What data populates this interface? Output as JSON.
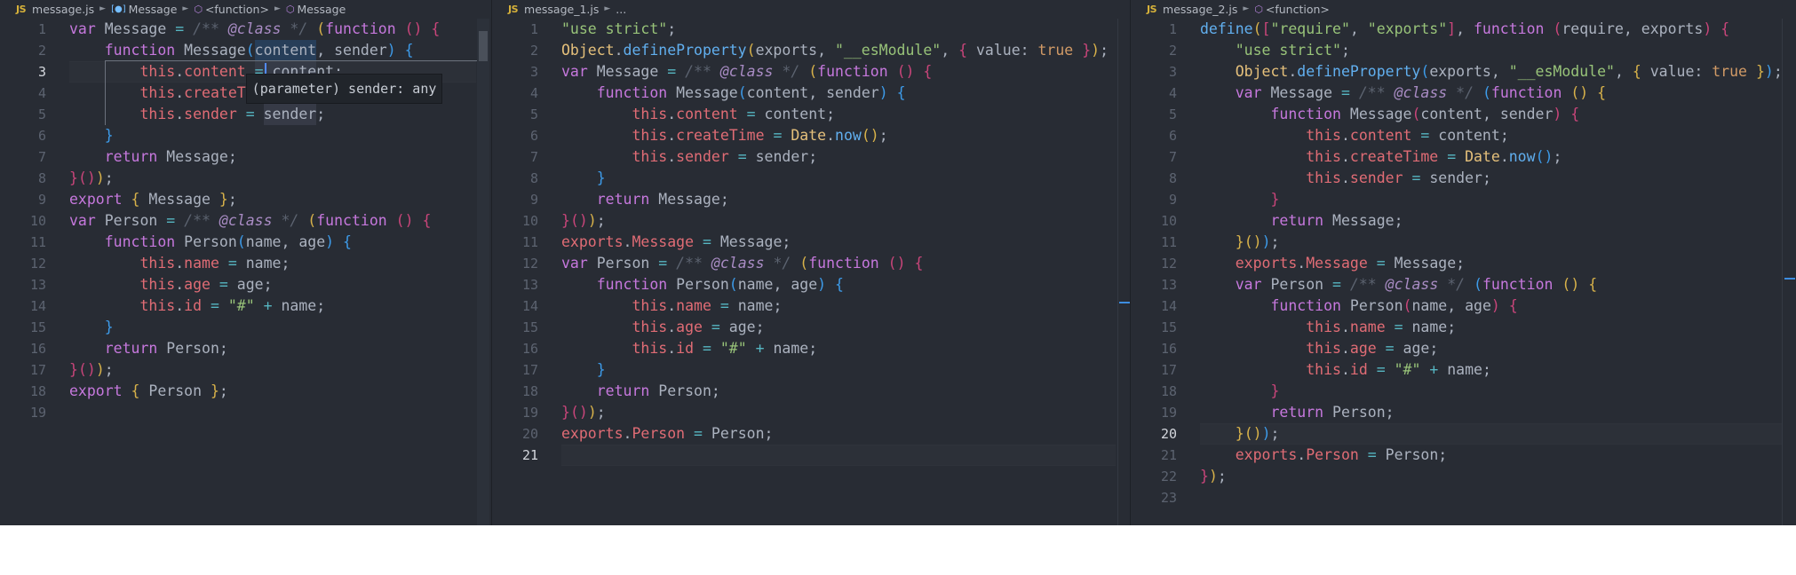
{
  "colors": {
    "background": "#282c34",
    "keyword": "#c678dd",
    "function": "#61afef",
    "property": "#e06c75",
    "string": "#98c379",
    "type": "#e5c07b",
    "operator": "#56b6c2",
    "comment": "#5c6370"
  },
  "editors": [
    {
      "breadcrumbs": {
        "file_icon": "JS",
        "file": "message.js",
        "items": [
          "Message",
          "<function>",
          "Message"
        ]
      },
      "active_line": 3,
      "hover": {
        "text": "(parameter) sender: any"
      },
      "lines": [
        "var Message = /** @class */ (function () {",
        "    function Message(content, sender) {",
        "        this.content = content;",
        "        this.createTime = Date.now();",
        "        this.sender = sender;",
        "    }",
        "    return Message;",
        "}());",
        "export { Message };",
        "var Person = /** @class */ (function () {",
        "    function Person(name, age) {",
        "        this.name = name;",
        "        this.age = age;",
        "        this.id = \"#\" + name;",
        "    }",
        "    return Person;",
        "}());",
        "export { Person };",
        ""
      ]
    },
    {
      "breadcrumbs": {
        "file_icon": "JS",
        "file": "message_1.js",
        "items": [
          "..."
        ]
      },
      "active_line": 21,
      "lines": [
        "\"use strict\";",
        "Object.defineProperty(exports, \"__esModule\", { value: true });",
        "var Message = /** @class */ (function () {",
        "    function Message(content, sender) {",
        "        this.content = content;",
        "        this.createTime = Date.now();",
        "        this.sender = sender;",
        "    }",
        "    return Message;",
        "}());",
        "exports.Message = Message;",
        "var Person = /** @class */ (function () {",
        "    function Person(name, age) {",
        "        this.name = name;",
        "        this.age = age;",
        "        this.id = \"#\" + name;",
        "    }",
        "    return Person;",
        "}());",
        "exports.Person = Person;",
        ""
      ]
    },
    {
      "breadcrumbs": {
        "file_icon": "JS",
        "file": "message_2.js",
        "items": [
          "<function>"
        ]
      },
      "active_line": 20,
      "lines": [
        "define([\"require\", \"exports\"], function (require, exports) {",
        "    \"use strict\";",
        "    Object.defineProperty(exports, \"__esModule\", { value: true });",
        "    var Message = /** @class */ (function () {",
        "        function Message(content, sender) {",
        "            this.content = content;",
        "            this.createTime = Date.now();",
        "            this.sender = sender;",
        "        }",
        "        return Message;",
        "    }());",
        "    exports.Message = Message;",
        "    var Person = /** @class */ (function () {",
        "        function Person(name, age) {",
        "            this.name = name;",
        "            this.age = age;",
        "            this.id = \"#\" + name;",
        "        }",
        "        return Person;",
        "    }());",
        "    exports.Person = Person;",
        "});",
        ""
      ]
    }
  ]
}
